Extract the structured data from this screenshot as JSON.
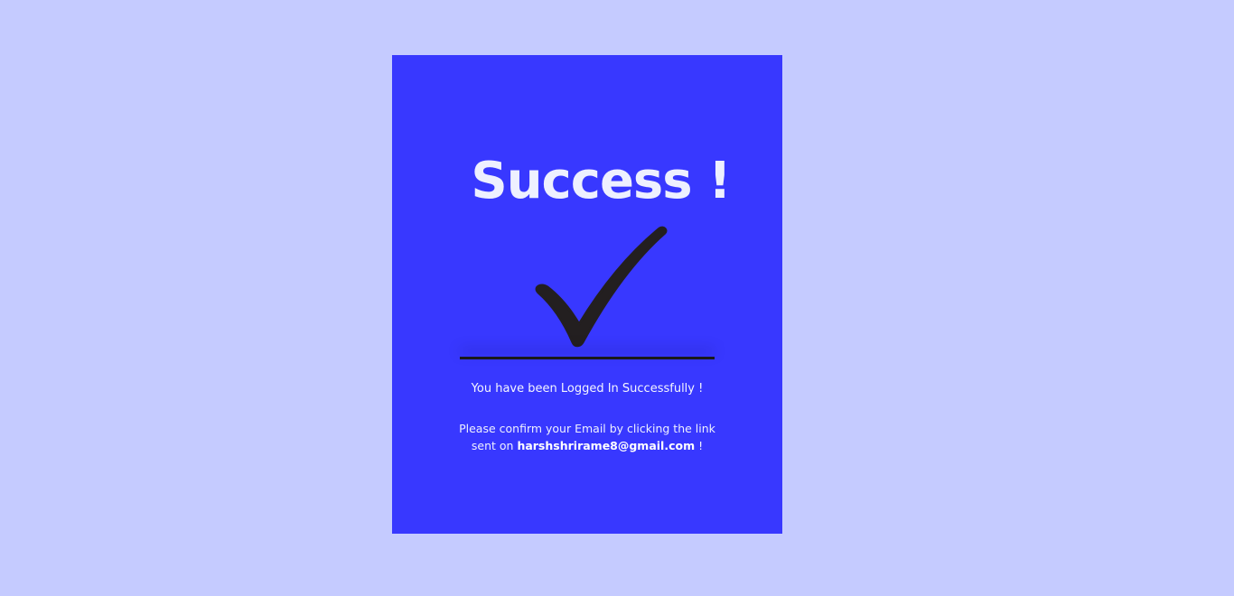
{
  "page": {
    "background_color": "#c5cbff",
    "card_color": "#3838ff"
  },
  "card": {
    "title": "Success !",
    "checkmark_icon": "checkmark-icon",
    "logged_in_message": "You have been Logged In Successfully !",
    "confirm_line1": "Please confirm your Email by clicking the link",
    "confirm_prefix": "sent on",
    "email": "harshshrirame8@gmail.com",
    "confirm_suffix": "!"
  }
}
